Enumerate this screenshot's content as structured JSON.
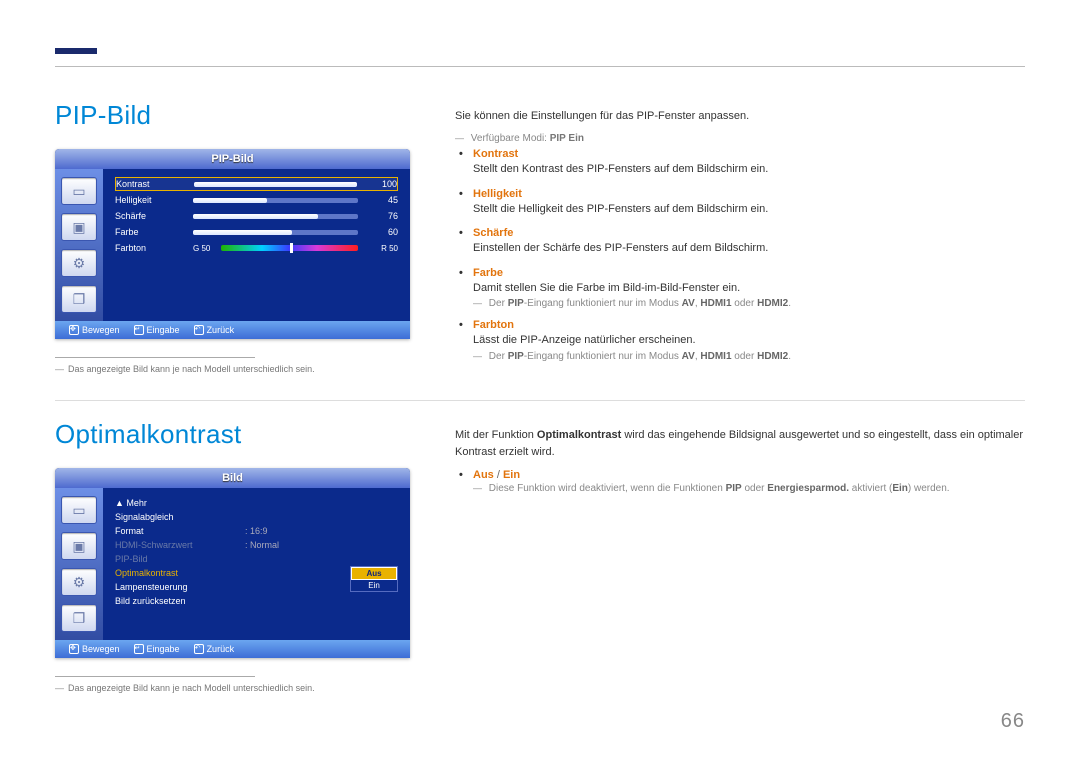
{
  "page_number": "66",
  "footnote": "Das angezeigte Bild kann je nach Modell unterschiedlich sein.",
  "section1": {
    "title": "PIP-Bild",
    "osd": {
      "title": "PIP-Bild",
      "rows": [
        {
          "label": "Kontrast",
          "value": "100",
          "fill": 100
        },
        {
          "label": "Helligkeit",
          "value": "45",
          "fill": 45
        },
        {
          "label": "Schärfe",
          "value": "76",
          "fill": 76
        },
        {
          "label": "Farbe",
          "value": "60",
          "fill": 60
        }
      ],
      "tint": {
        "label": "Farbton",
        "left": "G 50",
        "right": "R 50"
      },
      "footer": {
        "move": "Bewegen",
        "enter": "Eingabe",
        "return": "Zurück"
      }
    },
    "intro": "Sie können die Einstellungen für das PIP-Fenster anpassen.",
    "mode_note_prefix": "Verfügbare Modi: ",
    "mode_note_bold": "PIP Ein",
    "items": [
      {
        "head": "Kontrast",
        "desc": "Stellt den Kontrast des PIP-Fensters auf dem Bildschirm ein."
      },
      {
        "head": "Helligkeit",
        "desc": "Stellt die Helligkeit des PIP-Fensters auf dem Bildschirm ein."
      },
      {
        "head": "Schärfe",
        "desc": "Einstellen der Schärfe des PIP-Fensters auf dem Bildschirm."
      },
      {
        "head": "Farbe",
        "desc": "Damit stellen Sie die Farbe im Bild-im-Bild-Fenster ein."
      },
      {
        "head": "Farbton",
        "desc": "Lässt die PIP-Anzeige natürlicher erscheinen."
      }
    ],
    "pip_input_note": {
      "p1": "Der ",
      "b1": "PIP",
      "p2": "-Eingang funktioniert nur im Modus ",
      "b2": "AV",
      "p3": ", ",
      "b3": "HDMI1",
      "p4": " oder ",
      "b4": "HDMI2",
      "p5": "."
    }
  },
  "section2": {
    "title": "Optimalkontrast",
    "osd": {
      "title": "Bild",
      "more": "▲ Mehr",
      "rows": [
        {
          "label": "Signalabgleich",
          "value": "",
          "dim": false
        },
        {
          "label": "Format",
          "value": ": 16:9",
          "dim": false
        },
        {
          "label": "HDMI-Schwarzwert",
          "value": ": Normal",
          "dim": true
        },
        {
          "label": "PIP-Bild",
          "value": "",
          "dim": true
        },
        {
          "label": "Optimalkontrast",
          "value": "",
          "highlight": true
        },
        {
          "label": "Lampensteuerung",
          "value": "",
          "dim": false
        },
        {
          "label": "Bild zurücksetzen",
          "value": "",
          "dim": false
        }
      ],
      "dropdown": {
        "opt1": "Aus",
        "opt2": "Ein"
      },
      "footer": {
        "move": "Bewegen",
        "enter": "Eingabe",
        "return": "Zurück"
      }
    },
    "intro": {
      "p1": "Mit der Funktion ",
      "b1": "Optimalkontrast",
      "p2": " wird das eingehende Bildsignal ausgewertet und so eingestellt, dass ein optimaler Kontrast erzielt wird."
    },
    "option": {
      "a": "Aus",
      "sep": " / ",
      "b": "Ein"
    },
    "disable_note": {
      "p1": "Diese Funktion wird deaktiviert, wenn die Funktionen ",
      "b1": "PIP",
      "p2": " oder ",
      "b2": "Energiesparmod.",
      "p3": " aktiviert (",
      "b3": "Ein",
      "p4": ") werden."
    }
  }
}
